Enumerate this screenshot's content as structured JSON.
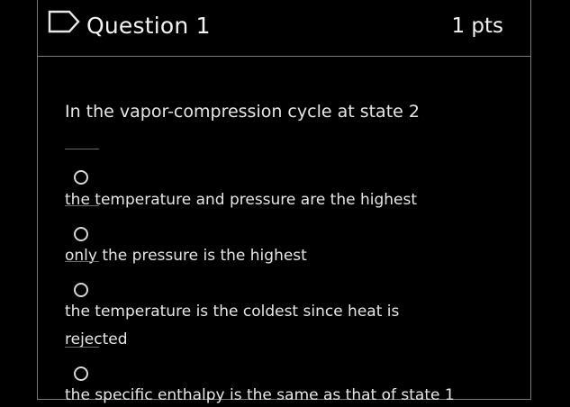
{
  "question": {
    "title": "Question 1",
    "points": "1 pts",
    "prompt": "In the vapor-compression cycle at state 2"
  },
  "answers": [
    {
      "label": "the temperature and pressure are the highest"
    },
    {
      "label": "only the pressure is the highest"
    },
    {
      "label": "the temperature is the coldest since heat is rejected"
    },
    {
      "label": "the specific enthalpy is the same as that of state 1"
    }
  ],
  "colors": {
    "background": "#000000",
    "text": "#e6e6e6",
    "border": "#7a7a7a"
  },
  "icons": {
    "flag": "bookmark-flag-icon",
    "radio": "radio-unchecked-icon"
  }
}
